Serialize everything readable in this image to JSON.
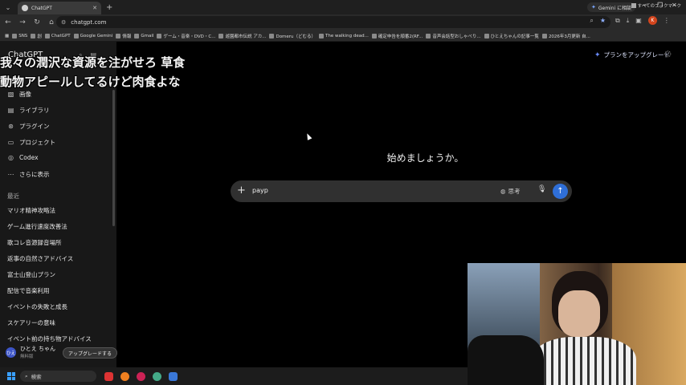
{
  "browser": {
    "tab_title": "ChatGPT",
    "url": "chatgpt.com",
    "gemini_chip": "Gemini に相談",
    "profile_initial": "K",
    "bookmarks": [
      "SNS",
      "創",
      "ChatGPT",
      "Google Gemini",
      "情報",
      "Gmail",
      "ゲーム・音楽・DVD・C...",
      "遊園都市伝説 アカ...",
      "Domeru（どむる）",
      "The walking dead...",
      "確定申告を順番2(RF...",
      "音声会話型おしゃべり...",
      "ひとえちゃんの記事一覧",
      "2026年3月更新 自..."
    ],
    "bookmarks_all": "すべてのブックマーク"
  },
  "caption": "我々の潤沢な資源を注がせろ 草食動物アピールしてるけど肉食よな",
  "sidebar": {
    "brand": "ChatGPT",
    "items": [
      {
        "label": "画像",
        "icon": "image-icon"
      },
      {
        "label": "ライブラリ",
        "icon": "library-icon"
      },
      {
        "label": "プラグイン",
        "icon": "plugin-icon"
      },
      {
        "label": "プロジェクト",
        "icon": "folder-icon"
      },
      {
        "label": "Codex",
        "icon": "codex-icon"
      },
      {
        "label": "さらに表示",
        "icon": "more-icon"
      }
    ],
    "recent_label": "最近",
    "chats": [
      "マリオ精神攻略法",
      "ゲーム進行速度改善法",
      "歌コレ音源録音場所",
      "返事の自然さアドバイス",
      "富士山登山プラン",
      "配信で音楽利用",
      "イベントの失敗と成長",
      "スケアリーの意味",
      "イベント前の持ち物アドバイス"
    ],
    "user": {
      "initials": "ひえ",
      "name": "ひとえ ちゃん",
      "plan": "無料版"
    },
    "upgrade_button": "アップグレードする"
  },
  "main": {
    "upgrade_plan": "プランをアップグレード",
    "heading": "始めましょうか。",
    "composer": {
      "value": "payp",
      "think_label": "思考"
    }
  },
  "taskbar": {
    "search_placeholder": "検索"
  }
}
